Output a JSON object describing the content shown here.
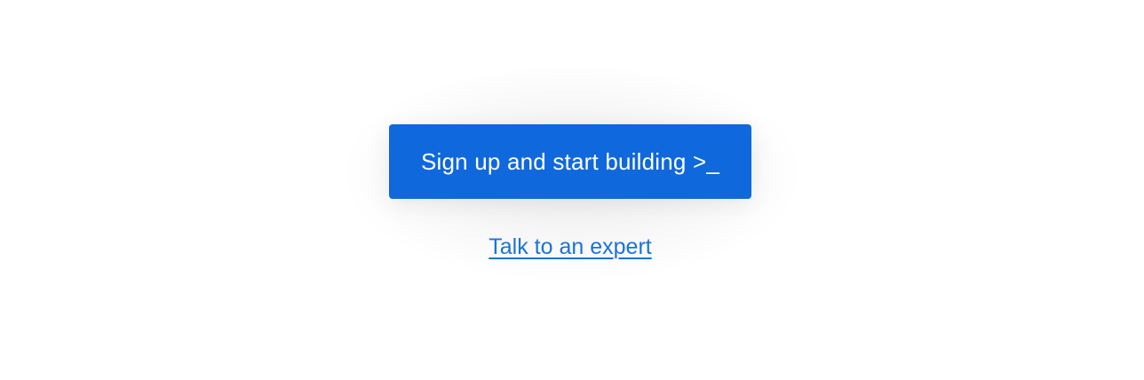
{
  "cta": {
    "primary_label": "Sign up and start building >_",
    "secondary_label": "Talk to an expert"
  },
  "colors": {
    "primary_button_bg": "#0f68dc",
    "primary_button_text": "#ffffff",
    "link": "#1a73d9",
    "page_bg": "#ffffff"
  }
}
